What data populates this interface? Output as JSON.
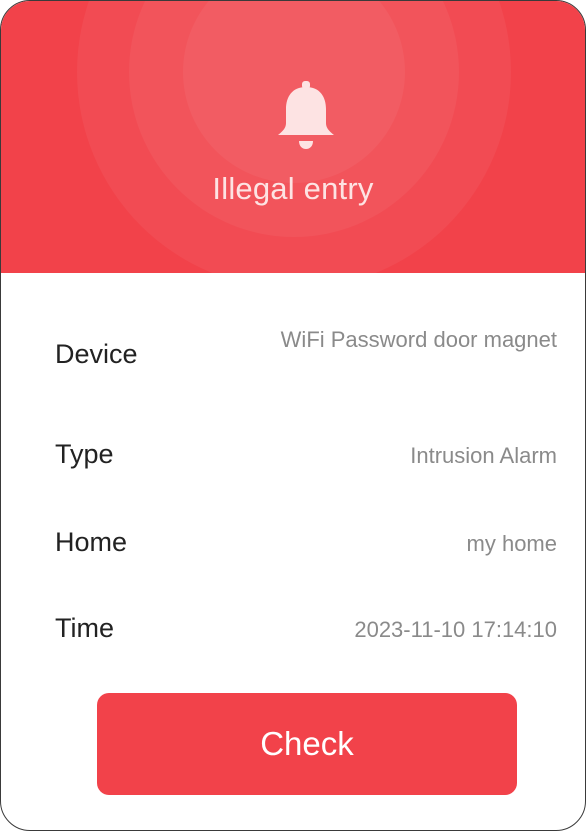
{
  "alert": {
    "title": "Illegal entry",
    "icon": "bell-icon",
    "accent_color": "#f2424a"
  },
  "details": [
    {
      "label": "Device",
      "value": "WiFi Password door magnet"
    },
    {
      "label": "Type",
      "value": "Intrusion Alarm"
    },
    {
      "label": "Home",
      "value": "my home"
    },
    {
      "label": "Time",
      "value": "2023-11-10 17:14:10"
    }
  ],
  "actions": {
    "check_label": "Check"
  }
}
